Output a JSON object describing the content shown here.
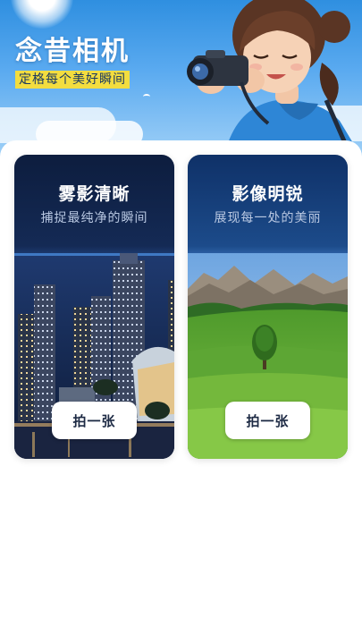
{
  "header": {
    "app_title": "念昔相机",
    "slogan": "定格每个美好瞬间"
  },
  "cards": [
    {
      "title": "雾影清晰",
      "subtitle": "捕捉最纯净的瞬间",
      "button_label": "拍一张",
      "scene": "night-city"
    },
    {
      "title": "影像明锐",
      "subtitle": "展现每一处的美丽",
      "button_label": "拍一张",
      "scene": "green-meadow"
    }
  ],
  "colors": {
    "slogan_highlight": "#f3dd3f",
    "card_dark_blue": "#0d1d3e",
    "button_bg": "#ffffff"
  }
}
